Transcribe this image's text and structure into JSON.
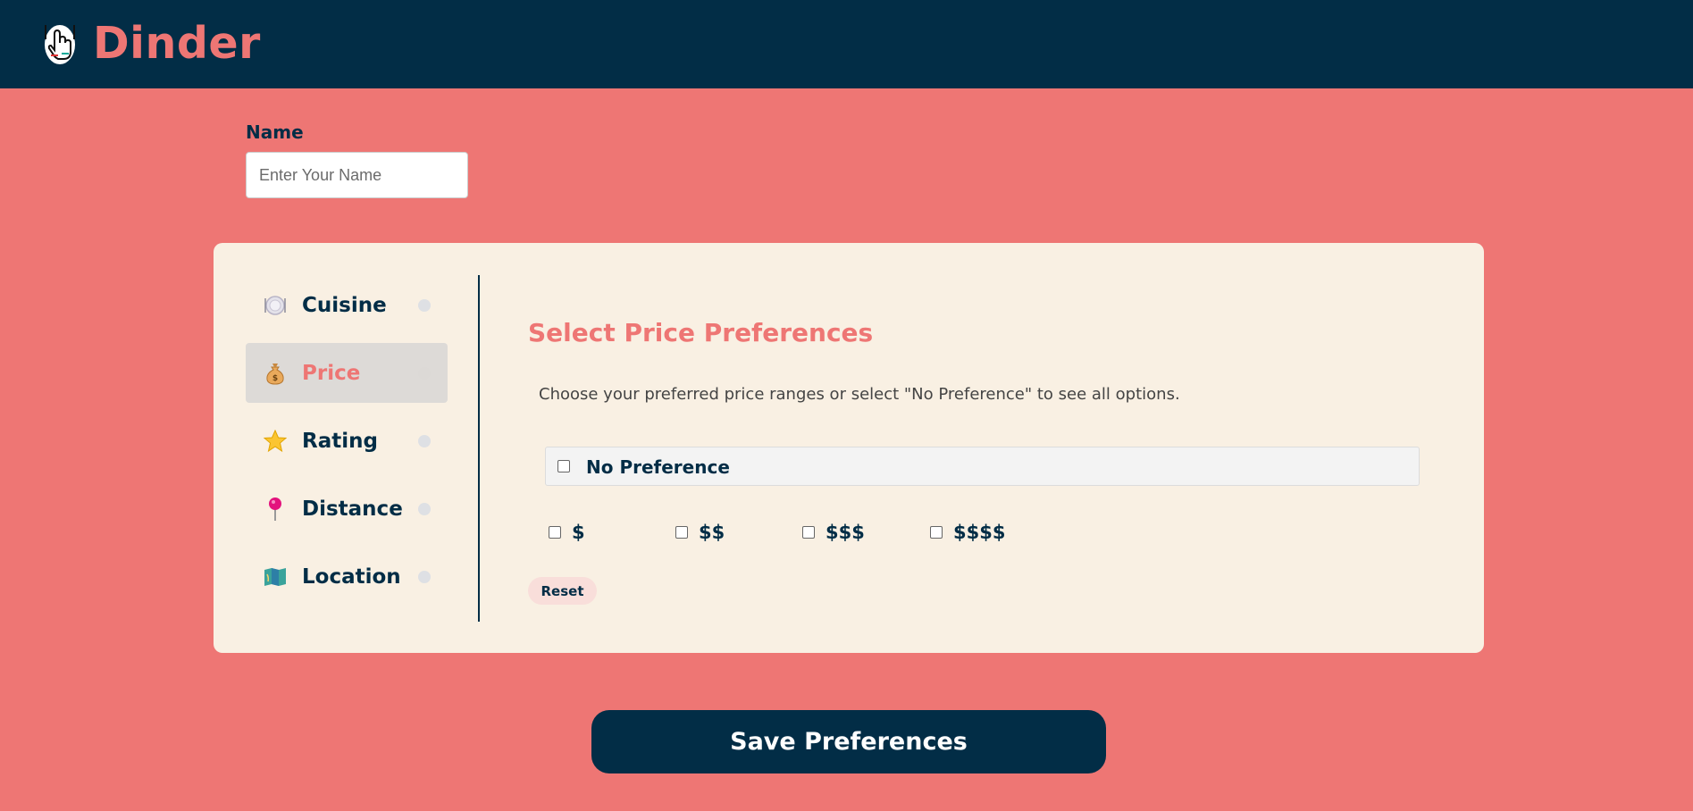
{
  "app": {
    "title": "Dinder",
    "logo_icon": "hand-pointer-icon"
  },
  "form": {
    "name_label": "Name",
    "name_placeholder": "Enter Your Name",
    "name_value": ""
  },
  "nav": {
    "items": [
      {
        "label": "Cuisine",
        "icon": "plate-icon",
        "active": false
      },
      {
        "label": "Price",
        "icon": "money-bag-icon",
        "active": true
      },
      {
        "label": "Rating",
        "icon": "star-icon",
        "active": false
      },
      {
        "label": "Distance",
        "icon": "pin-icon",
        "active": false
      },
      {
        "label": "Location",
        "icon": "map-icon",
        "active": false
      }
    ]
  },
  "panel": {
    "title": "Select Price Preferences",
    "description": "Choose your preferred price ranges or select \"No Preference\" to see all options.",
    "no_preference_label": "No Preference",
    "no_preference_checked": false,
    "options": [
      {
        "label": "$",
        "checked": false
      },
      {
        "label": "$$",
        "checked": false
      },
      {
        "label": "$$$",
        "checked": false
      },
      {
        "label": "$$$$",
        "checked": false
      }
    ],
    "reset_label": "Reset"
  },
  "actions": {
    "save_label": "Save Preferences"
  },
  "colors": {
    "navy": "#022D46",
    "coral": "#EE7674",
    "cream": "#F9F0E3"
  }
}
